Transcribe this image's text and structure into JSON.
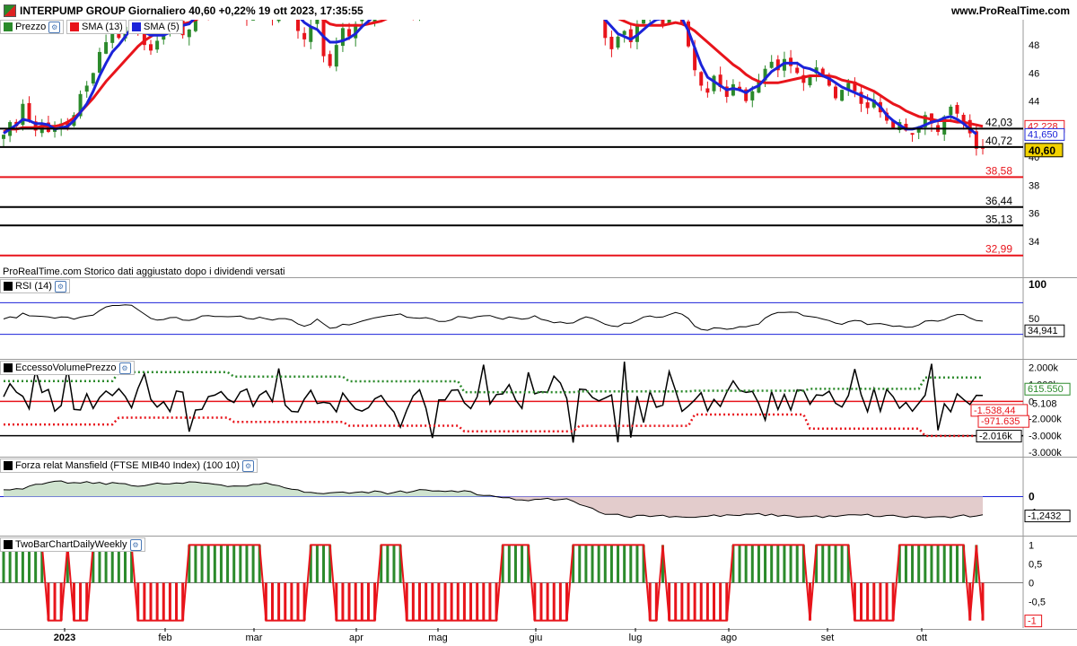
{
  "header": {
    "title": "INTERPUMP GROUP Giornaliero 40,60 +0,22% 19 ott 2023, 17:35:55",
    "site": "www.ProRealTime.com"
  },
  "price_panel": {
    "legend": [
      {
        "label": "Prezzo",
        "color": "#2b8a2b"
      },
      {
        "label": "SMA (13)",
        "color": "#e8141b"
      },
      {
        "label": "SMA (5)",
        "color": "#1b23d9"
      }
    ],
    "note": "ProRealTime.com Storico dati aggiustato dopo i dividendi versati"
  },
  "rsi_panel": {
    "legend": "RSI (14)"
  },
  "volume_panel": {
    "legend": "EccessoVolumePrezzo"
  },
  "mansfield_panel": {
    "legend": "Forza relat Mansfield (FTSE MIB40 Index) (100 10)"
  },
  "twobar_panel": {
    "legend": "TwoBarChartDailyWeekly"
  },
  "colors": {
    "up": "#2b8a2b",
    "down": "#e8141b",
    "sma13": "#e8141b",
    "sma5": "#1b23d9",
    "hline_black": "#000000",
    "hline_red": "#e8141b",
    "mansfield_pos": "#cfe3cf",
    "mansfield_neg": "#e3cccc"
  },
  "chart_data": [
    {
      "type": "candlestick",
      "name": "Prezzo",
      "ylim": [
        31.5,
        49.8
      ],
      "yticks": [
        34,
        36,
        38,
        40,
        42,
        44,
        46,
        48
      ],
      "x_labels": [
        "2023",
        "feb",
        "mar",
        "apr",
        "mag",
        "giu",
        "lug",
        "ago",
        "set",
        "ott"
      ],
      "last_close": "40,60",
      "sma13_last": "42,228",
      "sma5_last": "41,650",
      "levels": [
        {
          "value": 42.03,
          "label": "42,03",
          "color": "black"
        },
        {
          "value": 40.72,
          "label": "40,72",
          "color": "black"
        },
        {
          "value": 38.58,
          "label": "38,58",
          "color": "red"
        },
        {
          "value": 36.44,
          "label": "36,44",
          "color": "black"
        },
        {
          "value": 35.13,
          "label": "35,13",
          "color": "black"
        },
        {
          "value": 32.99,
          "label": "32,99",
          "color": "red"
        }
      ],
      "close_path": [
        41.6,
        42.5,
        42.2,
        43.8,
        42.6,
        41.9,
        42.3,
        41.8,
        42.0,
        42.4,
        42.1,
        43.0,
        44.5,
        45.1,
        46.0,
        47.5,
        48.2,
        48.8,
        48.5,
        49.3,
        49.5,
        49.2,
        48.0,
        47.6,
        48.3,
        48.9,
        49.4,
        49.6,
        48.7,
        49.1,
        50.5,
        51.0,
        50.3,
        50.8,
        51.2,
        50.6,
        51.0,
        50.4,
        49.9,
        50.7,
        51.4,
        50.2,
        49.8,
        50.9,
        51.3,
        50.5,
        49.0,
        48.4,
        49.3,
        50.6,
        47.2,
        46.5,
        48.0,
        49.2,
        48.6,
        49.5,
        50.2,
        49.8,
        50.4,
        51.1,
        50.6,
        51.3,
        51.8,
        50.9,
        50.2,
        51.5,
        52.0,
        51.6,
        50.8,
        51.1,
        52.4,
        53.0,
        52.1,
        51.5,
        52.7,
        53.3,
        52.6,
        51.9,
        52.8,
        53.5,
        52.2,
        51.6,
        52.9,
        53.2,
        52.0,
        50.8,
        51.7,
        52.4,
        51.0,
        50.3,
        51.6,
        52.1,
        50.9,
        50.2,
        48.5,
        47.7,
        48.6,
        49.0,
        48.2,
        49.5,
        49.8,
        50.6,
        50.1,
        49.4,
        50.9,
        51.2,
        49.6,
        47.9,
        46.2,
        45.1,
        44.6,
        45.8,
        45.0,
        44.3,
        45.2,
        44.8,
        44.0,
        44.7,
        45.4,
        46.3,
        46.8,
        46.2,
        47.0,
        46.5,
        46.0,
        45.3,
        45.8,
        46.4,
        45.7,
        45.1,
        44.2,
        44.8,
        45.3,
        44.7,
        43.8,
        43.5,
        44.1,
        43.2,
        42.6,
        42.1,
        42.5,
        41.9,
        41.6,
        42.2,
        43.0,
        42.4,
        41.8,
        42.9,
        43.6,
        43.1,
        42.5,
        41.7,
        40.6,
        40.6
      ],
      "sma13_path": [
        41.8,
        42.0,
        42.0,
        42.1,
        42.1,
        42.1,
        42.2,
        42.2,
        42.2,
        42.3,
        42.5,
        42.8,
        43.2,
        43.7,
        44.2,
        44.8,
        45.4,
        45.9,
        46.4,
        46.9,
        47.4,
        47.9,
        48.3,
        48.6,
        48.9,
        49.0,
        49.2,
        49.3,
        49.5,
        49.6,
        49.8,
        50.0,
        50.1,
        50.2,
        50.3,
        50.5,
        50.6,
        50.6,
        50.6,
        50.7,
        50.8,
        50.8,
        50.7,
        50.7,
        50.7,
        50.6,
        50.5,
        50.3,
        50.2,
        50.1,
        49.8,
        49.5,
        49.4,
        49.4,
        49.4,
        49.4,
        49.4,
        49.5,
        49.6,
        49.7,
        49.9,
        50.2,
        50.5,
        50.7,
        50.9,
        51.1,
        51.3,
        51.4,
        51.5,
        51.6,
        51.7,
        51.9,
        52.1,
        52.2,
        52.4,
        52.5,
        52.6,
        52.6,
        52.7,
        52.8,
        52.8,
        52.8,
        52.8,
        52.8,
        52.7,
        52.5,
        52.3,
        52.2,
        52.0,
        51.8,
        51.6,
        51.5,
        51.3,
        51.0,
        50.6,
        50.2,
        49.9,
        49.7,
        49.5,
        49.4,
        49.4,
        49.4,
        49.4,
        49.4,
        49.5,
        49.6,
        49.5,
        49.3,
        49.0,
        48.6,
        48.2,
        47.8,
        47.4,
        47.0,
        46.6,
        46.3,
        45.9,
        45.6,
        45.4,
        45.3,
        45.3,
        45.3,
        45.4,
        45.5,
        45.6,
        45.7,
        45.8,
        45.8,
        45.8,
        45.8,
        45.7,
        45.5,
        45.4,
        45.3,
        45.1,
        44.9,
        44.7,
        44.4,
        44.1,
        43.8,
        43.6,
        43.3,
        43.1,
        42.9,
        42.8,
        42.7,
        42.6,
        42.6,
        42.6,
        42.5,
        42.5,
        42.4,
        42.3,
        42.2
      ],
      "sma5_path": [
        41.7,
        42.0,
        42.3,
        42.7,
        42.6,
        42.4,
        42.4,
        42.3,
        42.0,
        42.1,
        42.2,
        42.6,
        43.2,
        43.8,
        44.7,
        45.8,
        46.7,
        47.5,
        48.0,
        48.6,
        49.2,
        49.3,
        48.9,
        48.7,
        48.7,
        48.7,
        48.9,
        49.2,
        49.4,
        49.5,
        50.0,
        50.4,
        50.6,
        50.8,
        51.1,
        50.9,
        50.8,
        50.6,
        50.4,
        50.5,
        50.7,
        50.5,
        50.4,
        50.6,
        50.8,
        50.6,
        50.1,
        49.6,
        49.3,
        49.1,
        48.6,
        48.2,
        48.2,
        48.3,
        48.5,
        48.8,
        49.3,
        49.7,
        50.1,
        50.6,
        50.9,
        51.3,
        51.6,
        51.5,
        51.3,
        51.3,
        51.4,
        51.5,
        51.5,
        51.5,
        51.7,
        52.1,
        52.2,
        52.2,
        52.3,
        52.6,
        52.6,
        52.5,
        52.6,
        52.7,
        52.5,
        52.3,
        52.4,
        52.6,
        52.4,
        51.9,
        51.7,
        51.6,
        51.4,
        51.1,
        50.8,
        50.9,
        50.8,
        50.5,
        49.8,
        49.3,
        48.8,
        48.6,
        48.4,
        48.7,
        49.1,
        49.5,
        49.8,
        49.9,
        50.2,
        50.2,
        49.9,
        49.0,
        47.8,
        46.6,
        45.7,
        45.4,
        45.1,
        44.8,
        44.9,
        44.8,
        44.6,
        44.9,
        45.1,
        45.6,
        46.1,
        46.4,
        46.7,
        46.7,
        46.7,
        46.4,
        46.3,
        46.1,
        45.8,
        45.6,
        45.3,
        45.0,
        44.8,
        44.6,
        44.4,
        44.2,
        44.0,
        43.6,
        43.0,
        42.6,
        42.3,
        42.0,
        42.0,
        42.1,
        42.3,
        42.5,
        42.6,
        42.8,
        42.9,
        42.7,
        42.4,
        42.0,
        41.65
      ]
    },
    {
      "type": "line",
      "name": "RSI (14)",
      "ylim": [
        0,
        100
      ],
      "yticks_labels": [
        "100",
        "50"
      ],
      "bands": [
        70,
        30
      ],
      "last_value": "34,941"
    },
    {
      "type": "line",
      "name": "EccessoVolumePrezzo",
      "ylim": [
        -3200,
        2400
      ],
      "yticks_labels": [
        "2.000k",
        "1.000k",
        "0",
        "-2.000k",
        "-3.000k"
      ],
      "yticks_values": [
        2000,
        1000,
        0,
        -1000,
        -2000,
        -3000
      ],
      "value_labels": [
        "-1.538,44",
        "615.550",
        "5.108",
        "-971.635",
        "-2.016k"
      ]
    },
    {
      "type": "area",
      "name": "Forza relat Mansfield (FTSE MIB40 Index) (100 10)",
      "ylim": [
        -2.5,
        2.5
      ],
      "yticks_labels": [
        "0",
        "-1"
      ],
      "last_value": "-1,2432"
    },
    {
      "type": "bar",
      "name": "TwoBarChartDailyWeekly",
      "ylim": [
        -1.2,
        1.2
      ],
      "yticks_labels": [
        "1",
        "0,5",
        "0",
        "-0,5",
        "-1"
      ],
      "last_value": "-1"
    }
  ]
}
